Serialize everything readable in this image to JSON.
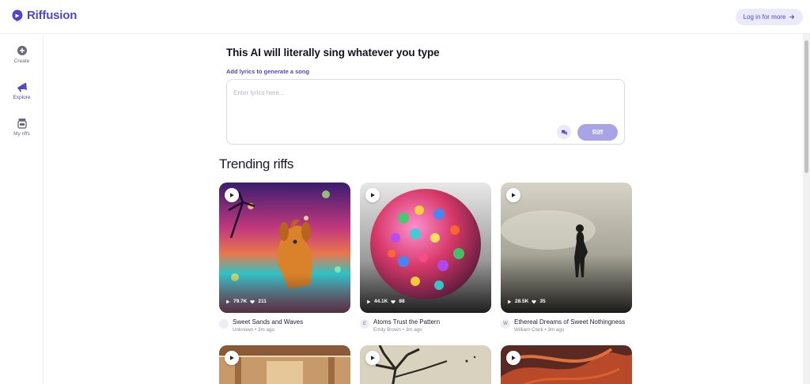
{
  "header": {
    "app_name": "Riffusion",
    "login_label": "Log in for more"
  },
  "sidebar": {
    "items": [
      {
        "label": "Create",
        "icon": "plus-circle-icon"
      },
      {
        "label": "Explore",
        "icon": "megaphone-icon",
        "active": true
      },
      {
        "label": "My riffs",
        "icon": "jar-icon"
      }
    ]
  },
  "composer": {
    "headline": "This AI will literally sing whatever you type",
    "add_lyrics_label": "Add lyrics to generate a song",
    "placeholder": "Enter lyrics here...",
    "riff_label": "Riff"
  },
  "trending": {
    "title": "Trending riffs",
    "cards": [
      {
        "title": "Sweet Sands and Waves",
        "author": "Unknown",
        "time": "3m ago",
        "meta": "Unknown • 3m ago",
        "avatar": "",
        "plays": "79.7K",
        "likes": "211"
      },
      {
        "title": "Atoms Trust the Pattern",
        "author": "Emily Brown",
        "time": "3m ago",
        "meta": "Emily Brown • 3m ago",
        "avatar": "E",
        "plays": "44.1K",
        "likes": "88"
      },
      {
        "title": "Ethereal Dreams of Sweet Nothingness",
        "author": "William Clark",
        "time": "3m ago",
        "meta": "William Clark • 3m ago",
        "avatar": "W",
        "plays": "28.5K",
        "likes": "35"
      }
    ]
  },
  "colors": {
    "brand": "#4f46c8",
    "riff_button": "#a8a4e6",
    "login_bg": "#ebeafc"
  }
}
